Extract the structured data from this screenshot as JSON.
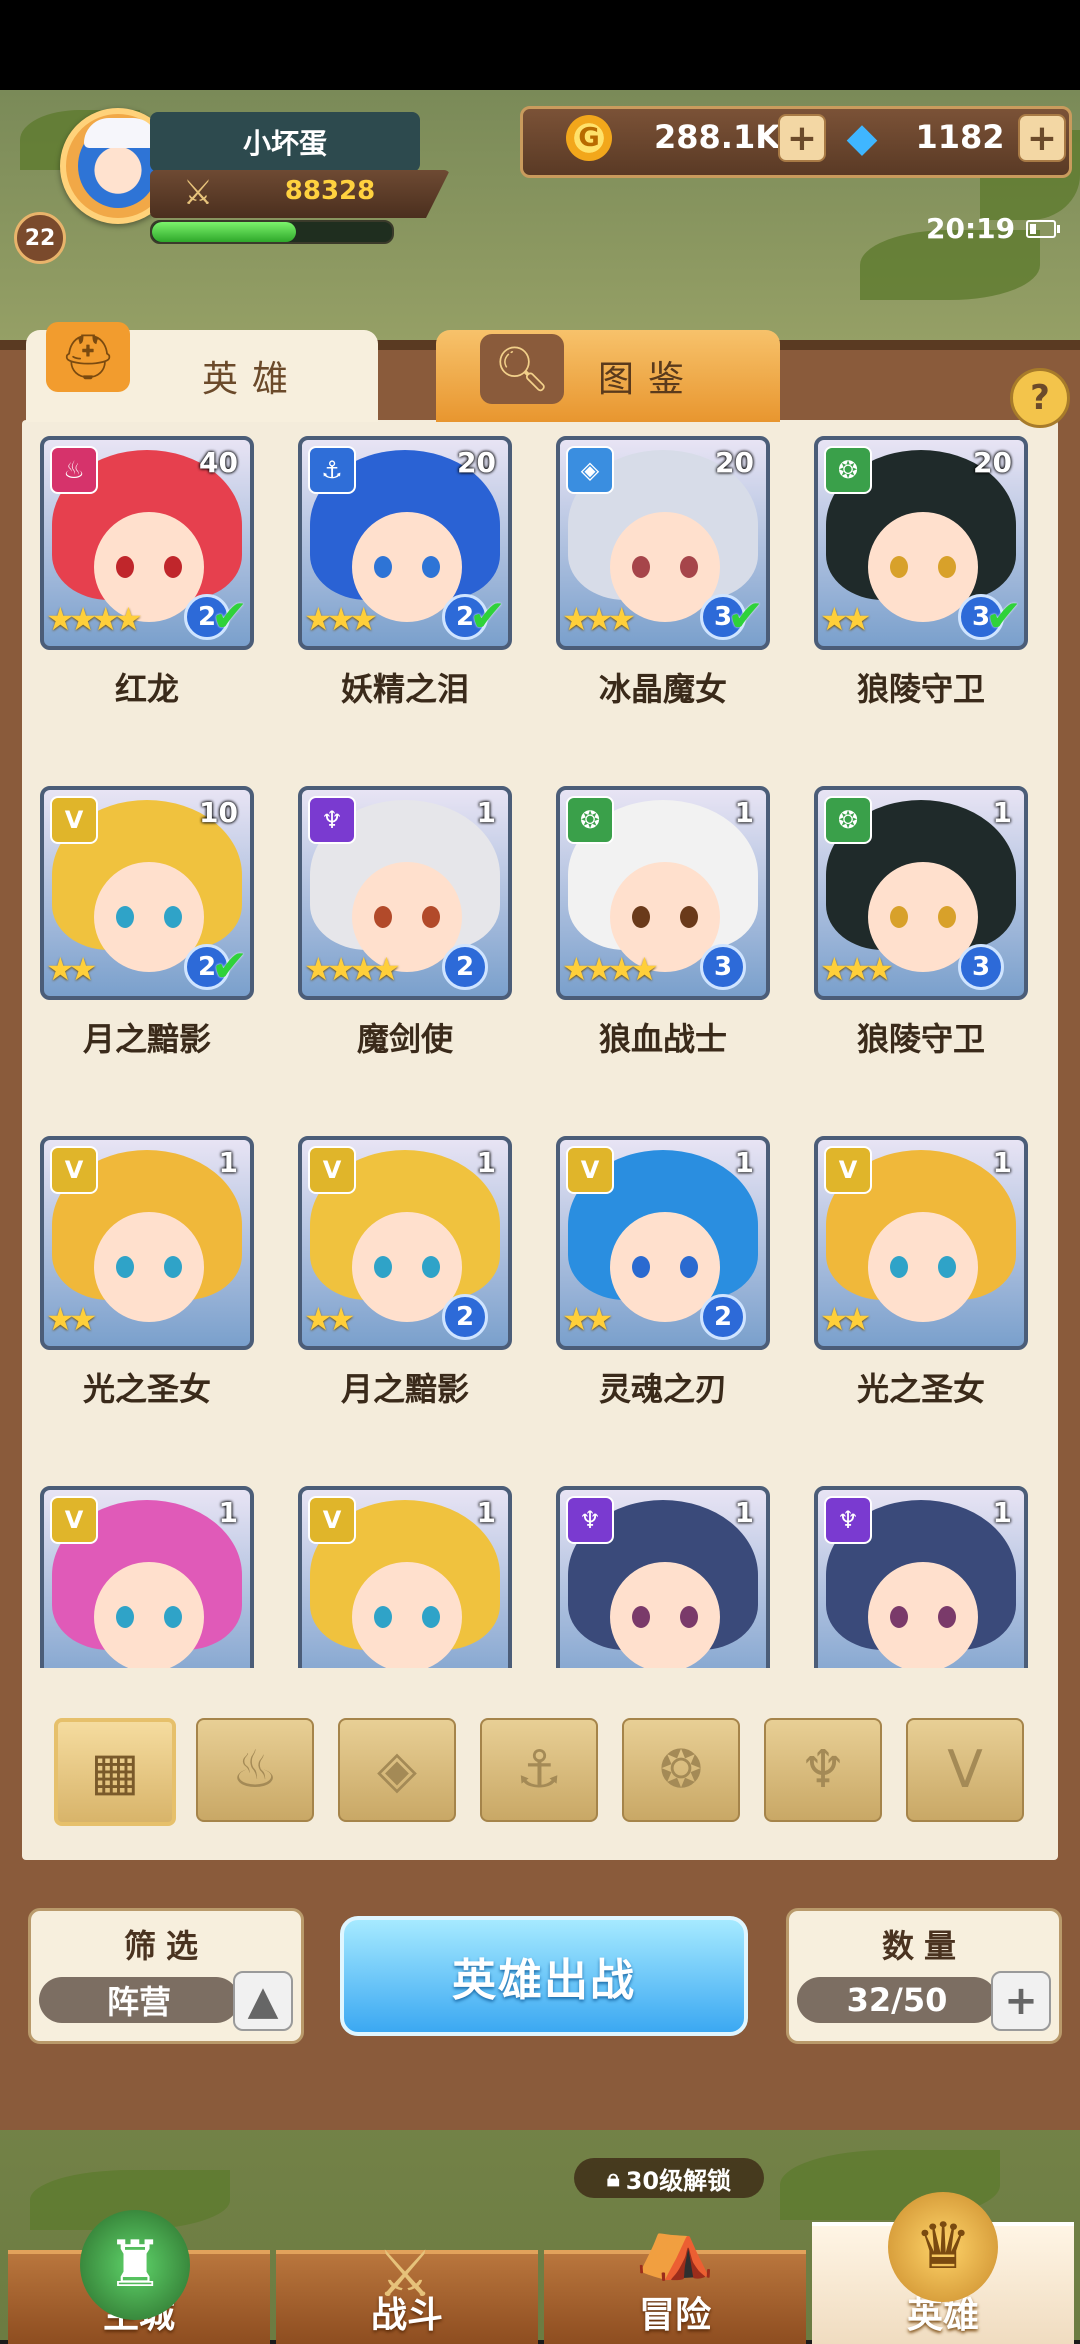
{
  "player": {
    "name": "小坏蛋",
    "level": "22",
    "power": "88328",
    "exp_fraction": 0.6
  },
  "resources": {
    "gold": "288.1K",
    "gems": "1182"
  },
  "status": {
    "time": "20:19"
  },
  "tabs": {
    "heroes": "英雄",
    "gallery": "图鉴"
  },
  "help_label": "?",
  "heroes": [
    {
      "name": "红龙",
      "level": "40",
      "stars": 4,
      "rank": "2",
      "ready": true,
      "faction": "flame",
      "faction_color": "#d6336b",
      "hair": "#e6404e",
      "eye": "#c0262b"
    },
    {
      "name": "妖精之泪",
      "level": "20",
      "stars": 3,
      "rank": "2",
      "ready": true,
      "faction": "anchor",
      "faction_color": "#2f6ed8",
      "hair": "#2a62d4",
      "eye": "#2e74d6"
    },
    {
      "name": "冰晶魔女",
      "level": "20",
      "stars": 3,
      "rank": "3",
      "ready": true,
      "faction": "crystal",
      "faction_color": "#3a8ee0",
      "hair": "#d7dce8",
      "eye": "#a6454a"
    },
    {
      "name": "狼陵守卫",
      "level": "20",
      "stars": 2,
      "rank": "3",
      "ready": true,
      "faction": "beast",
      "faction_color": "#3aa04a",
      "hair": "#1f2a2a",
      "eye": "#d8a12a"
    },
    {
      "name": "月之黯影",
      "level": "10",
      "stars": 2,
      "rank": "2",
      "ready": true,
      "faction": "light",
      "faction_color": "#e0b52a",
      "hair": "#f0c23e",
      "eye": "#2fa3c8"
    },
    {
      "name": "魔剑使",
      "level": "1",
      "stars": 4,
      "rank": "2",
      "ready": false,
      "faction": "dark",
      "faction_color": "#7a3ad0",
      "hair": "#e6e6ea",
      "eye": "#b24a2a"
    },
    {
      "name": "狼血战士",
      "level": "1",
      "stars": 4,
      "rank": "3",
      "ready": false,
      "faction": "beast",
      "faction_color": "#3aa04a",
      "hair": "#f2f2f2",
      "eye": "#6a3a1a"
    },
    {
      "name": "狼陵守卫",
      "level": "1",
      "stars": 3,
      "rank": "3",
      "ready": false,
      "faction": "beast",
      "faction_color": "#3aa04a",
      "hair": "#1f2a2a",
      "eye": "#d8a12a"
    },
    {
      "name": "光之圣女",
      "level": "1",
      "stars": 2,
      "rank": "",
      "ready": false,
      "faction": "light",
      "faction_color": "#e0b52a",
      "hair": "#f0b83a",
      "eye": "#2fa3c8"
    },
    {
      "name": "月之黯影",
      "level": "1",
      "stars": 2,
      "rank": "2",
      "ready": false,
      "faction": "light",
      "faction_color": "#e0b52a",
      "hair": "#f0c23e",
      "eye": "#2fa3c8"
    },
    {
      "name": "灵魂之刃",
      "level": "1",
      "stars": 2,
      "rank": "2",
      "ready": false,
      "faction": "light",
      "faction_color": "#e0b52a",
      "hair": "#2a8ee0",
      "eye": "#2a6ad0"
    },
    {
      "name": "光之圣女",
      "level": "1",
      "stars": 2,
      "rank": "",
      "ready": false,
      "faction": "light",
      "faction_color": "#e0b52a",
      "hair": "#f0b83a",
      "eye": "#2fa3c8"
    },
    {
      "name": "",
      "level": "1",
      "stars": 0,
      "rank": "",
      "ready": false,
      "faction": "light",
      "faction_color": "#e0b52a",
      "hair": "#e05ab8",
      "eye": "#2fa3c8"
    },
    {
      "name": "",
      "level": "1",
      "stars": 0,
      "rank": "",
      "ready": false,
      "faction": "light",
      "faction_color": "#e0b52a",
      "hair": "#f0c23e",
      "eye": "#2fa3c8"
    },
    {
      "name": "",
      "level": "1",
      "stars": 0,
      "rank": "",
      "ready": false,
      "faction": "dark",
      "faction_color": "#7a3ad0",
      "hair": "#3a4a7a",
      "eye": "#7a3a6a"
    },
    {
      "name": "",
      "level": "1",
      "stars": 0,
      "rank": "",
      "ready": false,
      "faction": "dark",
      "faction_color": "#7a3ad0",
      "hair": "#3a4a7a",
      "eye": "#7a3a6a"
    }
  ],
  "faction_filters": [
    {
      "icon": "grid-icon",
      "glyph": "▦",
      "active": true
    },
    {
      "icon": "flame-faction-icon",
      "glyph": "♨",
      "active": false
    },
    {
      "icon": "crystal-faction-icon",
      "glyph": "◈",
      "active": false
    },
    {
      "icon": "anchor-faction-icon",
      "glyph": "⚓",
      "active": false
    },
    {
      "icon": "beast-faction-icon",
      "glyph": "❂",
      "active": false
    },
    {
      "icon": "dark-faction-icon",
      "glyph": "♆",
      "active": false
    },
    {
      "icon": "light-faction-icon",
      "glyph": "V",
      "active": false
    }
  ],
  "filter_panel": {
    "label": "筛选",
    "value": "阵营"
  },
  "deploy_label": "英雄出战",
  "count_panel": {
    "label": "数量",
    "value": "32/50"
  },
  "nav": {
    "main_city": "主城",
    "battle": "战斗",
    "adventure": "冒险",
    "heroes": "英雄",
    "unlock_hint": "30级解锁"
  },
  "colors": {
    "accent_gold": "#ffd23f",
    "deploy_blue": "#3ba8f2",
    "board_brown": "#8a5b3b"
  }
}
